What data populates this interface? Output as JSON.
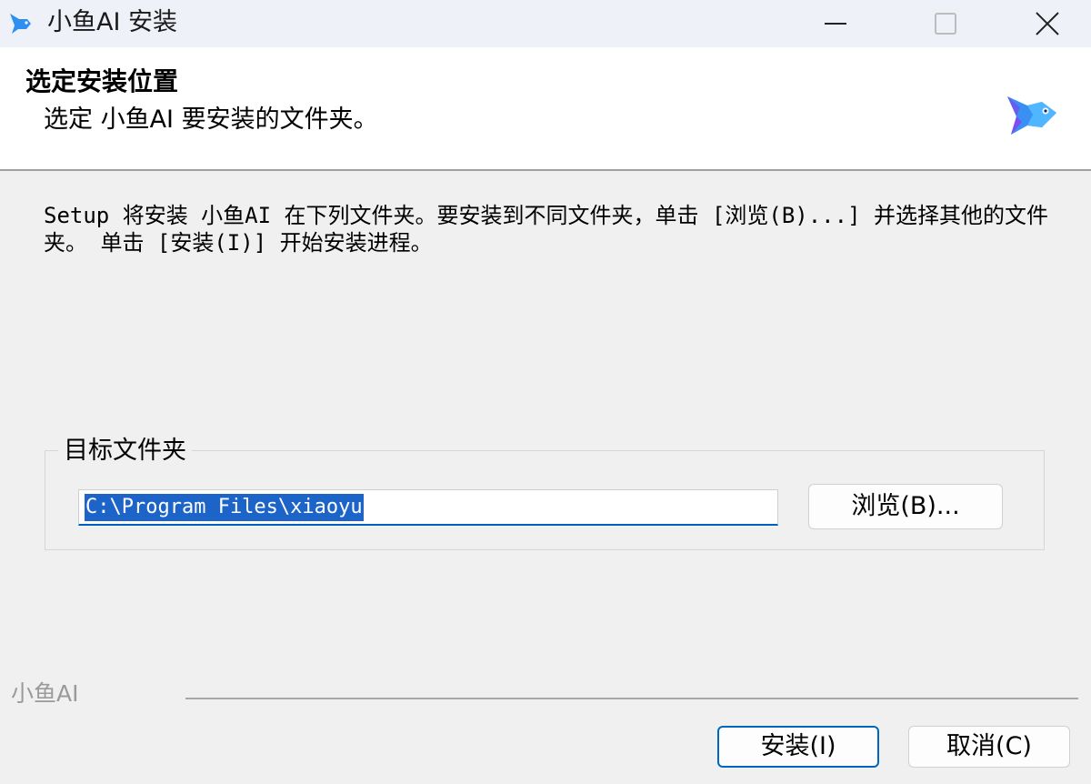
{
  "window": {
    "title": "小鱼AI 安装",
    "app_icon": "fish-icon",
    "controls": [
      "minimize-icon",
      "maximize-icon",
      "close-icon"
    ]
  },
  "header": {
    "title": "选定安装位置",
    "subtitle": "选定 小鱼AI 要安装的文件夹。",
    "logo": "fish-logo-icon"
  },
  "body": {
    "description": "Setup 将安装 小鱼AI 在下列文件夹。要安装到不同文件夹，单击 [浏览(B)...] 并选择其他的文件夹。 单击 [安装(I)] 开始安装进程。"
  },
  "destination": {
    "group_label": "目标文件夹",
    "path_value": "C:\\Program Files\\xiaoyu",
    "browse_label": "浏览(B)..."
  },
  "footer": {
    "brand": "小鱼AI",
    "install_label": "安装(I)",
    "cancel_label": "取消(C)"
  },
  "colors": {
    "accent": "#0067c0",
    "selection": "#1c64c8",
    "icon_blue": "#2f8ff0"
  }
}
